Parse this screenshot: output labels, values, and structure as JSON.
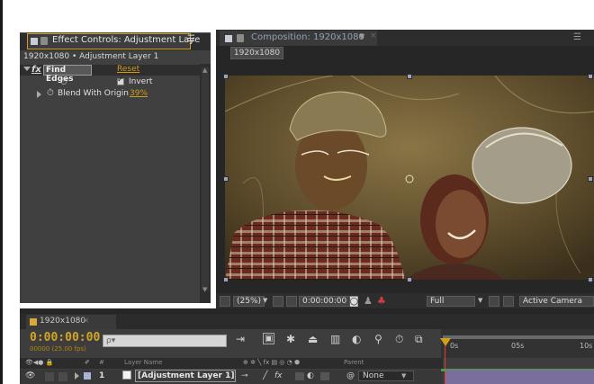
{
  "effect_controls": {
    "tab_label": "Effect Controls: Adjustment Laye",
    "menu_icon": "panel-menu-icon",
    "path": "1920x1080 • Adjustment Layer 1",
    "effect": {
      "fx_glyph": "fx",
      "name": "Find Edges",
      "reset_label": "Reset",
      "invert_label": "Invert",
      "invert_checked": true,
      "blend_label": "Blend With Origin",
      "blend_value": "39%"
    }
  },
  "composition": {
    "tab_label": "Composition: 1920x1080",
    "crumb": "1920x1080",
    "toolbar": {
      "zoom": "(25%)",
      "timecode": "0:00:00:00",
      "resolution": "Full",
      "camera": "Active Camera"
    }
  },
  "timeline": {
    "tab_label": "1920x1080",
    "timecode": "0:00:00:00",
    "fps": "00000 (25.00 fps)",
    "search_placeholder": "ρ▾",
    "ruler": [
      "0s",
      "05s",
      "10s"
    ],
    "headers": {
      "hash": "#",
      "layer_name": "Layer Name",
      "parent": "Parent"
    },
    "layer": {
      "number": "1",
      "name": "[Adjustment Layer 1]",
      "fx": "fx",
      "parent": "None"
    }
  },
  "colors": {
    "accent_orange": "#d39a17",
    "timecode_gold": "#d5a622",
    "layer_bar": "#7a6e9c",
    "cti_red": "#e03c31"
  }
}
